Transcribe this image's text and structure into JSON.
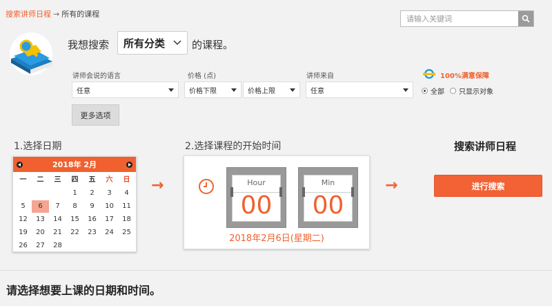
{
  "breadcrumb": {
    "link": "搜索讲师日程",
    "separator": "→",
    "current": "所有的课程"
  },
  "search": {
    "placeholder": "请输入关键词"
  },
  "sentence": {
    "prefix": "我想搜索",
    "suffix": "的课程。",
    "category": "所有分类"
  },
  "filters": {
    "language": {
      "label": "讲师会说的语言",
      "value": "任意"
    },
    "price": {
      "label": "价格 (点)",
      "min": "价格下限",
      "max": "价格上限"
    },
    "origin": {
      "label": "讲师来自",
      "value": "任意"
    }
  },
  "more_options": "更多选项",
  "guarantee": {
    "text": "100%满意保障",
    "radio_all": "全部",
    "radio_only": "只显示对象"
  },
  "step1": {
    "title": "1.选择日期"
  },
  "calendar": {
    "title": "2018年 2月",
    "weekdays": [
      "一",
      "二",
      "三",
      "四",
      "五",
      "六",
      "日"
    ],
    "weeks": [
      [
        "",
        "",
        "",
        "1",
        "2",
        "3",
        "4"
      ],
      [
        "5",
        "6",
        "7",
        "8",
        "9",
        "10",
        "11"
      ],
      [
        "12",
        "13",
        "14",
        "15",
        "16",
        "17",
        "18"
      ],
      [
        "19",
        "20",
        "21",
        "22",
        "23",
        "24",
        "25"
      ],
      [
        "26",
        "27",
        "28",
        "",
        "",
        "",
        ""
      ]
    ],
    "selected": "6"
  },
  "step2": {
    "title": "2.选择课程的开始时间"
  },
  "time": {
    "hour_label": "Hour",
    "hour_value": "00",
    "min_label": "Min",
    "min_value": "00",
    "date_text": "2018年2月6日(星期二)"
  },
  "step3": {
    "title": "搜索讲师日程"
  },
  "go_button": "进行搜索",
  "arrow": "→",
  "bottom_message": "请选择想要上课的日期和时间。",
  "colors": {
    "accent": "#f0612f",
    "weekend": "#e84e2a",
    "selected_day": "#f5a590"
  }
}
